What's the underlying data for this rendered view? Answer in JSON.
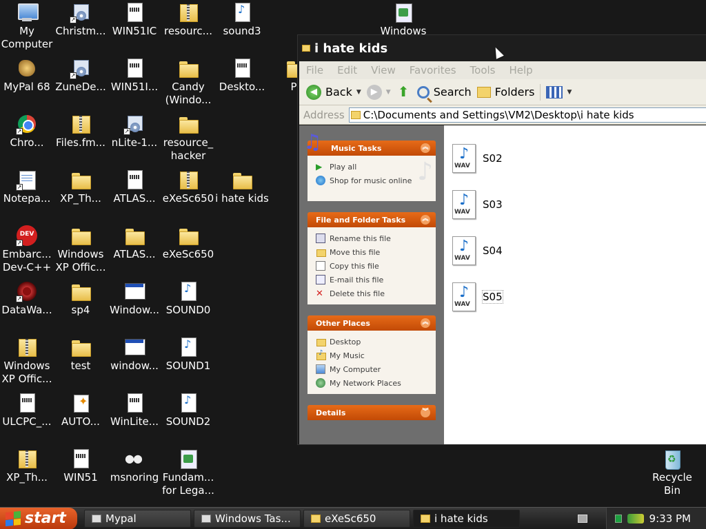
{
  "desktop": {
    "icons": [
      {
        "label": "My Computer",
        "icon": "computer-icon"
      },
      {
        "label": "Christm...",
        "icon": "setup-icon"
      },
      {
        "label": "WIN51IC",
        "icon": "text-file-icon"
      },
      {
        "label": "resourc...",
        "icon": "zip-folder-icon"
      },
      {
        "label": "sound3",
        "icon": "wav-file-icon"
      },
      {
        "label": "Windows",
        "icon": "picture-icon"
      },
      {
        "label": "MyPal 68",
        "icon": "mypal-icon"
      },
      {
        "label": "ZuneDe...",
        "icon": "setup-icon"
      },
      {
        "label": "WIN51I...",
        "icon": "text-file-icon"
      },
      {
        "label": "Candy (Windo...",
        "icon": "folder-icon"
      },
      {
        "label": "Deskto...",
        "icon": "text-file-icon"
      },
      {
        "label": "Pr",
        "icon": "folder-icon"
      },
      {
        "label": "Chro...",
        "icon": "chrome-icon"
      },
      {
        "label": "Files.fm...",
        "icon": "zip-folder-icon"
      },
      {
        "label": "nLite-1...",
        "icon": "setup-icon"
      },
      {
        "label": "resource_ hacker",
        "icon": "folder-icon"
      },
      {
        "label": "Notepa...",
        "icon": "notepad-icon"
      },
      {
        "label": "XP_Th...",
        "icon": "folder-icon"
      },
      {
        "label": "ATLAS...",
        "icon": "text-file-icon"
      },
      {
        "label": "eXeSc650",
        "icon": "zip-folder-icon"
      },
      {
        "label": "i hate kids",
        "icon": "folder-icon"
      },
      {
        "label": "Embarc... Dev-C++",
        "icon": "devcpp-icon"
      },
      {
        "label": "Windows XP Offic...",
        "icon": "folder-icon"
      },
      {
        "label": "ATLAS...",
        "icon": "folder-icon"
      },
      {
        "label": "eXeSc650",
        "icon": "folder-icon"
      },
      {
        "label": "DataWa...",
        "icon": "datawave-icon"
      },
      {
        "label": "sp4",
        "icon": "folder-icon"
      },
      {
        "label": "Window...",
        "icon": "window-icon"
      },
      {
        "label": "SOUND0",
        "icon": "wav-file-icon"
      },
      {
        "label": "Windows XP Offic...",
        "icon": "zip-folder-icon"
      },
      {
        "label": "test",
        "icon": "folder-icon"
      },
      {
        "label": "window...",
        "icon": "window-icon"
      },
      {
        "label": "SOUND1",
        "icon": "wav-file-icon"
      },
      {
        "label": "ULCPC_...",
        "icon": "text-file-icon"
      },
      {
        "label": "AUTO...",
        "icon": "autorun-icon"
      },
      {
        "label": "WinLite...",
        "icon": "text-file-icon"
      },
      {
        "label": "SOUND2",
        "icon": "wav-file-icon"
      },
      {
        "label": "XP_Th...",
        "icon": "zip-folder-icon"
      },
      {
        "label": "WIN51",
        "icon": "text-file-icon"
      },
      {
        "label": "msnoring",
        "icon": "msn-icon"
      },
      {
        "label": "Fundam... for Lega...",
        "icon": "picture-icon"
      },
      {
        "label": "Recycle Bin",
        "icon": "recycle-bin-icon"
      }
    ]
  },
  "explorer": {
    "title": "i hate kids",
    "menu": [
      "File",
      "Edit",
      "View",
      "Favorites",
      "Tools",
      "Help"
    ],
    "toolbar": {
      "back": "Back",
      "search": "Search",
      "folders": "Folders"
    },
    "address": {
      "label": "Address",
      "path": "C:\\Documents and Settings\\VM2\\Desktop\\i hate kids"
    },
    "tasks": {
      "music": {
        "title": "Music Tasks",
        "items": [
          "Play all",
          "Shop for music online"
        ]
      },
      "file_folder": {
        "title": "File and Folder Tasks",
        "items": [
          "Rename this file",
          "Move this file",
          "Copy this file",
          "E-mail this file",
          "Delete this file"
        ]
      },
      "other_places": {
        "title": "Other Places",
        "items": [
          "Desktop",
          "My Music",
          "My Computer",
          "My Network Places"
        ]
      },
      "details": {
        "title": "Details"
      }
    },
    "files": [
      {
        "name": "S02",
        "tag": "WAV"
      },
      {
        "name": "S03",
        "tag": "WAV"
      },
      {
        "name": "S04",
        "tag": "WAV"
      },
      {
        "name": "S05",
        "tag": "WAV"
      }
    ]
  },
  "taskbar": {
    "start": "start",
    "tasks": [
      "Mypal",
      "Windows Tas...",
      "eXeSc650",
      "i hate kids"
    ],
    "clock": "9:33 PM"
  }
}
